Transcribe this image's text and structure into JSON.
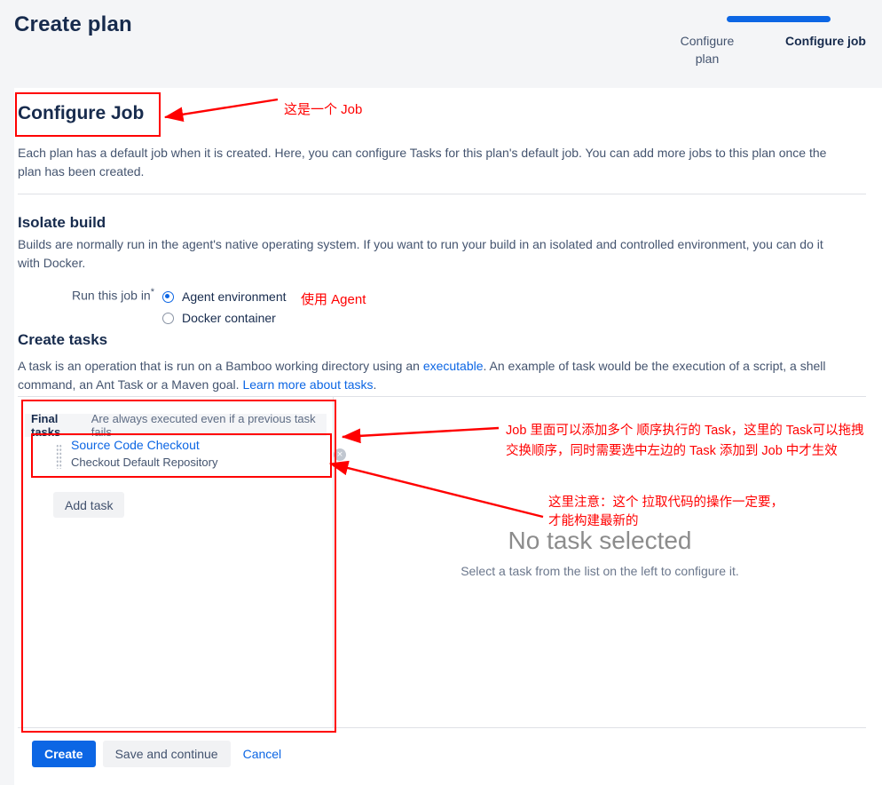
{
  "header": {
    "title": "Create plan",
    "wizard": {
      "steps": [
        {
          "label": "Configure plan",
          "current": false
        },
        {
          "label": "Configure job",
          "current": true
        }
      ],
      "progress_color": "#0c66e4"
    }
  },
  "configure_job": {
    "title": "Configure Job",
    "description": "Each plan has a default job when it is created. Here, you can configure Tasks for this plan's default job. You can add more jobs to this plan once the plan has been created."
  },
  "isolate_build": {
    "title": "Isolate build",
    "description": "Builds are normally run in the agent's native operating system. If you want to run your build in an isolated and controlled environment, you can do it with Docker.",
    "field_label": "Run this job in",
    "required_marker": "*",
    "options": [
      {
        "label": "Agent environment",
        "selected": true
      },
      {
        "label": "Docker container",
        "selected": false
      }
    ]
  },
  "create_tasks": {
    "title": "Create tasks",
    "description_part1": "A task is an operation that is run on a Bamboo working directory using an ",
    "link1": "executable",
    "description_part2": ". An example of task would be the execution of a script, a shell command, an Ant Task or a Maven goal. ",
    "link2": "Learn more about tasks",
    "description_part3": "."
  },
  "task_list": {
    "group_header_bold": "Final tasks",
    "group_header_rest": "Are always executed even if a previous task fails",
    "items": [
      {
        "title": "Source Code Checkout",
        "subtitle": "Checkout Default Repository",
        "remove_icon": "×"
      }
    ],
    "add_button": "Add task"
  },
  "task_detail": {
    "empty_title": "No task selected",
    "empty_subtitle": "Select a task from the list on the left to configure it."
  },
  "footer": {
    "create": "Create",
    "save_and_continue": "Save and continue",
    "cancel": "Cancel"
  },
  "annotations": {
    "color": "#ff0000",
    "job": "这是一个 Job",
    "agent": "使用 Agent",
    "tasks": "Job 里面可以添加多个 顺序执行的 Task，这里的 Task可以拖拽交换顺序，同时需要选中左边的 Task 添加到 Job 中才生效",
    "note": "这里注意：这个 拉取代码的操作一定要，\n才能构建最新的"
  }
}
